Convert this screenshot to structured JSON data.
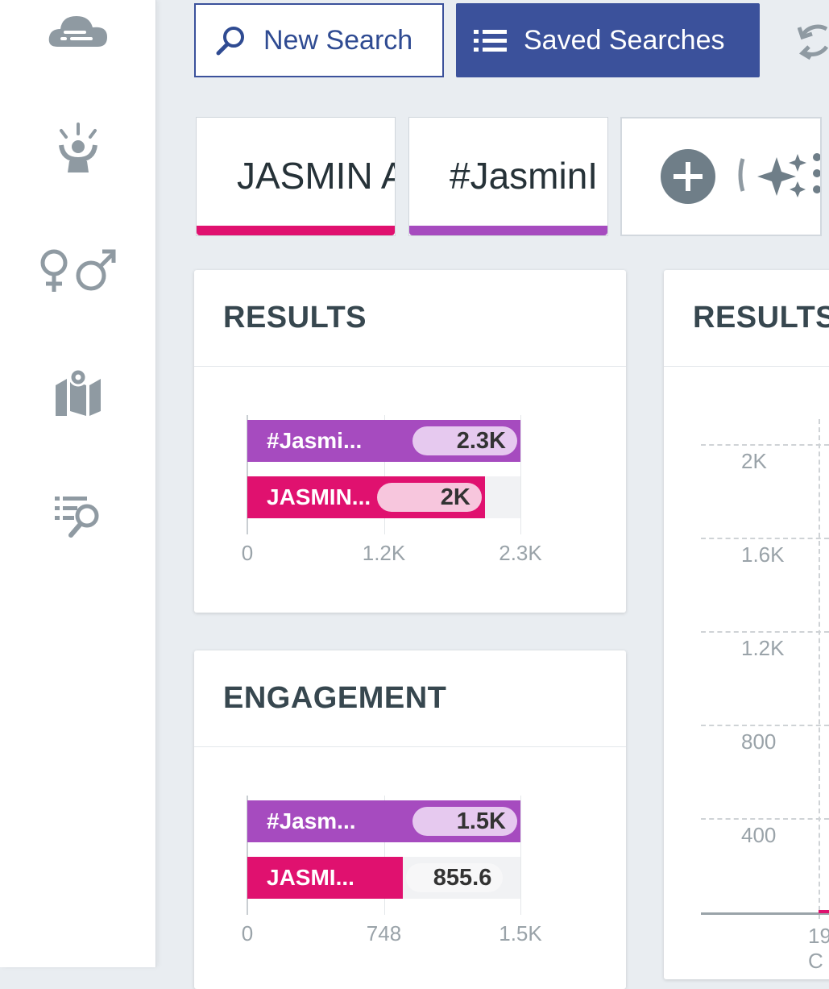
{
  "toolbar": {
    "new_search_label": "New Search",
    "saved_searches_label": "Saved Searches"
  },
  "colors": {
    "primary": "#3b519b",
    "series_pink": "#e0116f",
    "series_purple": "#a64bbf",
    "pill_purple": "#e6c9ef",
    "pill_pink": "#f7c6dd"
  },
  "tabs": [
    {
      "label": "JASMIN A",
      "color": "#e0116f"
    },
    {
      "label": "#JasminI",
      "color": "#a64bbf"
    }
  ],
  "sidebar": {
    "icons": [
      "cloud-icon",
      "spotlight-person-icon",
      "gender-icon",
      "map-pin-icon",
      "list-search-icon"
    ]
  },
  "cards": {
    "results_title": "RESULTS",
    "engagement_title": "ENGAGEMENT",
    "results_right_title": "RESULTS"
  },
  "chart_data": [
    {
      "type": "bar",
      "orientation": "horizontal",
      "title": "RESULTS",
      "categories": [
        "#Jasmi...",
        "JASMIN..."
      ],
      "values": [
        2300,
        2000
      ],
      "value_labels": [
        "2.3K",
        "2K"
      ],
      "xlim": [
        0,
        2300
      ],
      "xticks": [
        "0",
        "1.2K",
        "2.3K"
      ]
    },
    {
      "type": "bar",
      "orientation": "horizontal",
      "title": "ENGAGEMENT",
      "categories": [
        "#Jasm...",
        "JASMI..."
      ],
      "values": [
        1500,
        855.6
      ],
      "value_labels": [
        "1.5K",
        "855.6"
      ],
      "xlim": [
        0,
        1500
      ],
      "xticks": [
        "0",
        "748",
        "1.5K"
      ]
    },
    {
      "type": "line",
      "title": "RESULTS",
      "yticks": [
        "2K",
        "1.6K",
        "1.2K",
        "800",
        "400"
      ],
      "xticks": [
        "19 C"
      ]
    }
  ]
}
